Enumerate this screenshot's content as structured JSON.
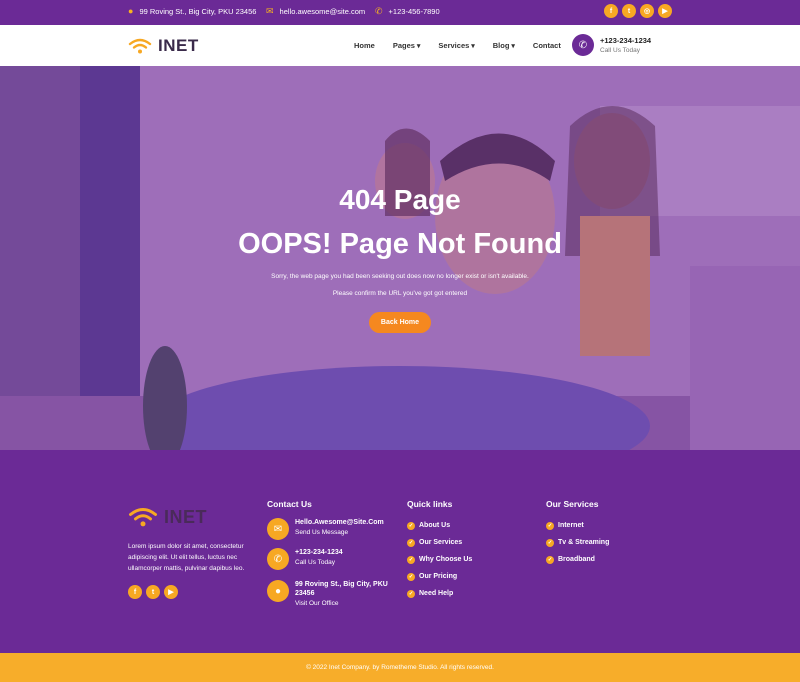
{
  "topbar": {
    "address": "99 Roving St., Big City, PKU 23456",
    "email": "hello.awesome@site.com",
    "phone": "+123-456-7890",
    "social": [
      "facebook-icon",
      "twitter-icon",
      "instagram-icon",
      "youtube-icon"
    ]
  },
  "navbar": {
    "logo": "INET",
    "items": [
      {
        "label": "Home"
      },
      {
        "label": "Pages"
      },
      {
        "label": "Services"
      },
      {
        "label": "Blog"
      },
      {
        "label": "Contact"
      }
    ],
    "call_number": "+123-234-1234",
    "call_label": "Call Us Today"
  },
  "hero": {
    "title": "404 Page",
    "subtitle": "OOPS! Page Not Found",
    "text1": "Sorry, the web page you had been seeking out does now no longer exist or isn't available.",
    "text2": "Please confirm the URL you've got got entered",
    "button": "Back Home"
  },
  "footer": {
    "logo": "INET",
    "about": "Lorem ipsum dolor sit amet, consectetur adipiscing elit. Ut elit tellus, luctus nec ullamcorper mattis, pulvinar dapibus leo.",
    "contact_heading": "Contact Us",
    "contact": [
      {
        "main": "Hello.Awesome@Site.Com",
        "sub": "Send Us Message"
      },
      {
        "main": "+123-234-1234",
        "sub": "Call Us Today"
      },
      {
        "main": "99 Roving St., Big City, PKU 23456",
        "sub": "Visit Our Office"
      }
    ],
    "quick_heading": "Quick links",
    "quick_links": [
      "About Us",
      "Our Services",
      "Why Choose Us",
      "Our Pricing",
      "Need Help"
    ],
    "services_heading": "Our Services",
    "services": [
      "Internet",
      "Tv & Streaming",
      "Broadband"
    ],
    "copyright": "© 2022 Inet Company. by Rometheme Studio. All rights reserved."
  },
  "colors": {
    "purple": "#6b2a96",
    "orange": "#f5881f",
    "yellow": "#f7a823"
  }
}
